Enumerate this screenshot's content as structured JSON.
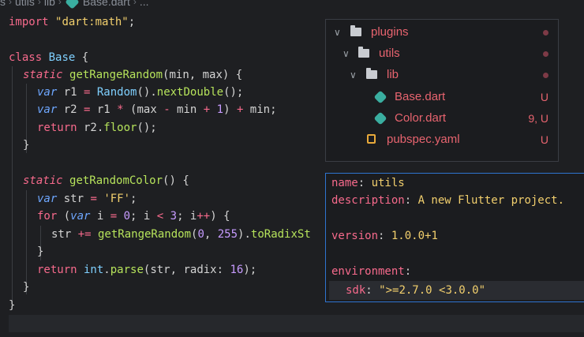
{
  "breadcrumb": {
    "segments": [
      "s",
      "utils",
      "lib",
      "Base.dart",
      "..."
    ]
  },
  "code": {
    "line1": {
      "kw": "import",
      "str": "\"dart:math\"",
      "tail": ";"
    },
    "line3": {
      "kw": "class",
      "name": "Base",
      "tail": " {"
    },
    "line4": {
      "kw": "static",
      "fn": "getRangeRandom",
      "params": "(min, max) {"
    },
    "line5": {
      "kw": "var",
      "a": " r1 ",
      "eq": "=",
      "cls": " Random",
      "p": "().",
      "fn": "nextDouble",
      "tail": "();"
    },
    "line6": {
      "kw": "var",
      "a": " r2 ",
      "eq": "=",
      "b": " r1 ",
      "op1": "*",
      "c": " (max ",
      "op2": "-",
      "d": " min ",
      "op3": "+",
      "num": " 1",
      "e": ") ",
      "op4": "+",
      "f": " min;"
    },
    "line7": {
      "kw": "return",
      "a": " r2.",
      "fn": "floor",
      "tail": "();"
    },
    "line8": {
      "text": "}"
    },
    "line10": {
      "kw": "static",
      "fn": "getRandomColor",
      "tail": "() {"
    },
    "line11": {
      "kw": "var",
      "a": " str ",
      "eq": "=",
      "str": " 'FF'",
      "tail": ";"
    },
    "line12": {
      "kw": "for",
      "a": " (",
      "kw2": "var",
      "b": " i ",
      "eq": "=",
      "n0": " 0",
      "c": "; i ",
      "lt": "<",
      "n3": " 3",
      "d": "; i",
      "pp": "++",
      "e": ") {"
    },
    "line13": {
      "a": "str ",
      "pe": "+=",
      "fn": " getRangeRandom",
      "b": "(",
      "n0": "0",
      "c": ", ",
      "n255": "255",
      "d": ").",
      "fn2": "toRadixSt"
    },
    "line14": {
      "text": "}"
    },
    "line15": {
      "kw": "return",
      "cls": " int",
      "a": ".",
      "fn": "parse",
      "b": "(str, radix: ",
      "num": "16",
      "tail": ");"
    },
    "line16": {
      "text": "}"
    },
    "line17": {
      "text": "}"
    }
  },
  "file_tree": {
    "items": [
      {
        "label": "plugins",
        "type": "folder",
        "marker": "dot"
      },
      {
        "label": "utils",
        "type": "folder",
        "marker": "dot"
      },
      {
        "label": "lib",
        "type": "folder",
        "marker": "dot"
      },
      {
        "label": "Base.dart",
        "type": "dart",
        "status": "U"
      },
      {
        "label": "Color.dart",
        "type": "dart",
        "status": "9, U"
      },
      {
        "label": "pubspec.yaml",
        "type": "yaml",
        "status": "U"
      }
    ]
  },
  "yaml_hover": {
    "name_key": "name",
    "name_val": "utils",
    "desc_key": "description",
    "desc_val": "A new Flutter project.",
    "version_key": "version",
    "version_val": "1.0.0+1",
    "env_key": "environment",
    "sdk_key": "sdk",
    "sdk_val": "\">=2.7.0 <3.0.0\""
  },
  "colors": {
    "keyword": "#f76a8c",
    "function": "#b6e35b",
    "class": "#7fd0ff",
    "string": "#f2cf6d",
    "number": "#c79bff",
    "var": "#6ea7ff",
    "hover_border": "#2f74d0",
    "git_untracked": "#e8646f"
  }
}
